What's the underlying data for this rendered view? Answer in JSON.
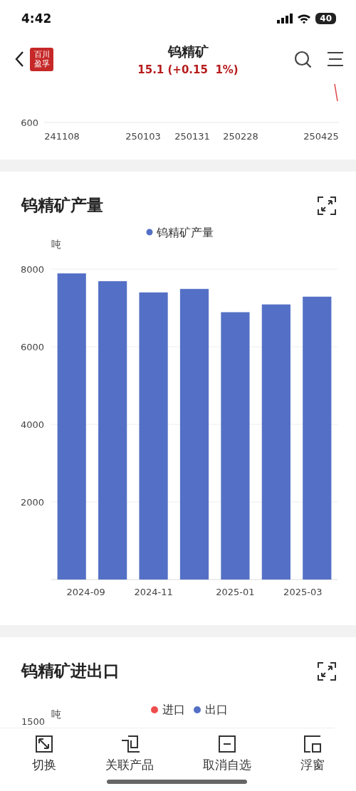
{
  "status_bar": {
    "time": "4:42",
    "battery": "40"
  },
  "header": {
    "logo_text": [
      "百川",
      "盈孚"
    ],
    "title": "钨精矿",
    "quote": "15.1 (+0.15  1%)"
  },
  "price_chart": {
    "y_tick": "600",
    "x_labels": [
      "241108",
      "250103",
      "250131",
      "250228",
      "250425"
    ]
  },
  "output_card": {
    "title": "钨精矿产量",
    "unit": "吨",
    "chart_data": {
      "type": "bar",
      "categories": [
        "2024-09",
        null,
        "2024-11",
        null,
        "2025-01",
        null,
        "2025-03"
      ],
      "series": [
        {
          "name": "钨精矿产量",
          "color": "#5470c6",
          "values": [
            7890,
            7690,
            7400,
            7490,
            6890,
            7090,
            7290
          ]
        }
      ],
      "ylim": [
        0,
        8000
      ],
      "yticks": [
        2000,
        4000,
        6000,
        8000
      ],
      "grid": true
    }
  },
  "trade_card": {
    "title": "钨精矿进出口",
    "unit": "吨",
    "legend": [
      {
        "name": "进口",
        "color": "#ee4d4d"
      },
      {
        "name": "出口",
        "color": "#5470c6"
      }
    ],
    "y_tick": "1500"
  },
  "toolbar": [
    {
      "kind": "switch",
      "label": "切换"
    },
    {
      "kind": "related",
      "label": "关联产品"
    },
    {
      "kind": "unwatch",
      "label": "取消自选"
    },
    {
      "kind": "float",
      "label": "浮窗"
    }
  ]
}
